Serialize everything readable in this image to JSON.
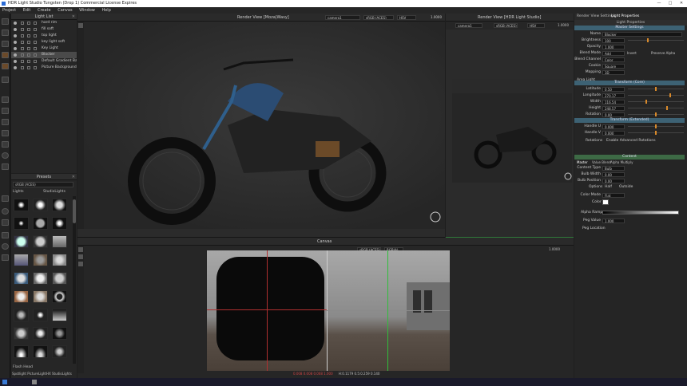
{
  "window": {
    "title": "HDR Light Studio Tungsten (Drop 1) Commercial License Expires",
    "controls": [
      "—",
      "□",
      "✕"
    ]
  },
  "menu": [
    "Project",
    "Edit",
    "Create",
    "Canvas",
    "Window",
    "Help"
  ],
  "light_list": {
    "title": "Light List",
    "items": [
      {
        "label": "hard rim",
        "selected": false
      },
      {
        "label": "fill soft",
        "selected": false
      },
      {
        "label": "top light",
        "selected": false
      },
      {
        "label": "key light soft",
        "selected": false
      },
      {
        "label": "Key Light",
        "selected": false
      },
      {
        "label": "Blocker",
        "selected": true
      },
      {
        "label": "Default Gradient Back...",
        "selected": false
      },
      {
        "label": "Picture Background",
        "selected": false
      }
    ]
  },
  "presets": {
    "title": "Presets",
    "colorspace": "sRGB (ACES)",
    "category": "Lights",
    "subcategory": "StudioLights",
    "hover_label": "Flash Head",
    "footer": "Spotlight PictureLightHX StudioLights"
  },
  "render_view_main": {
    "title": "Render View [Moza|Wasy]",
    "camera": "camera1",
    "colorspace": "sRGB (ACES)",
    "display": "HSV",
    "exposure": "1.0000",
    "footer_mode": "LightPaint: Reflection",
    "frame": "Frame 1"
  },
  "render_view_small": {
    "title": "Render View [HDR Light Studio]",
    "camera": "camera1",
    "colorspace": "sRGB (ACES)",
    "display": "HSV",
    "exposure": "1.0000",
    "footer_mode": "LightPaint: Rim",
    "frame": "Frame 0"
  },
  "canvas": {
    "title": "Canvas",
    "colorspace": "sRGB (ACES)",
    "channels": "RGB(A)",
    "exposure": "1.0000",
    "status_rgb": "0.008 0.008 0.008 1.000",
    "status_coords": "H:0.1179 0.5:0.259 0.140"
  },
  "properties": {
    "tabs": [
      "Render View Settings",
      "Light Properties"
    ],
    "header": "Light Properties",
    "master_settings": "Master Settings",
    "name": "Blocker",
    "brightness": "100",
    "opacity": "1.000",
    "blend_mode": "Add",
    "invert": "Invert",
    "preserve_alpha": "Preserve Alpha",
    "blend_channel": "Color",
    "cookie": "Square",
    "mapping": "3D",
    "area_light": "Area Light",
    "transform_core": "Transform (Core)",
    "latitude": "0.50",
    "longitude": "270.17",
    "width": "116.54",
    "height": "248.57",
    "rotation": "0.00",
    "transform_extended": "Transform (Extended)",
    "handle_u": "0.000",
    "handle_v": "0.000",
    "rotations": "Rotations",
    "advanced_rotations": "Enable Advanced Rotations",
    "content": "Content",
    "content_tabs": [
      "Master",
      "Value Blend",
      "Alpha Multiply"
    ],
    "content_type": "Bulb",
    "bulb_width": "0.00",
    "bulb_position": "0.00",
    "options": "Options",
    "half": "Half",
    "outside": "Outside",
    "color_mode": "Flat",
    "color": "Color",
    "alpha_ramp": "Alpha Ramp",
    "peg_value": "1.000",
    "peg_location": "Peg Location",
    "labels": {
      "name": "Name",
      "brightness": "Brightness",
      "opacity": "Opacity",
      "blend_mode": "Blend Mode",
      "blend_channel": "Blend Channel",
      "cookie": "Cookie",
      "mapping": "Mapping",
      "latitude": "Latitude",
      "longitude": "Longitude",
      "width": "Width",
      "height": "Height",
      "rotation": "Rotation",
      "handle_u": "Handle U",
      "handle_v": "Handle V",
      "content_type": "Content Type",
      "bulb_width": "Bulb Width",
      "bulb_position": "Bulb Position",
      "color_mode": "Color Mode",
      "peg_value": "Peg Value"
    }
  },
  "colors": {
    "accent": "#d98a2b",
    "section_blue": "#3d6274",
    "section_green": "#3d6a45",
    "panel": "#262626"
  }
}
